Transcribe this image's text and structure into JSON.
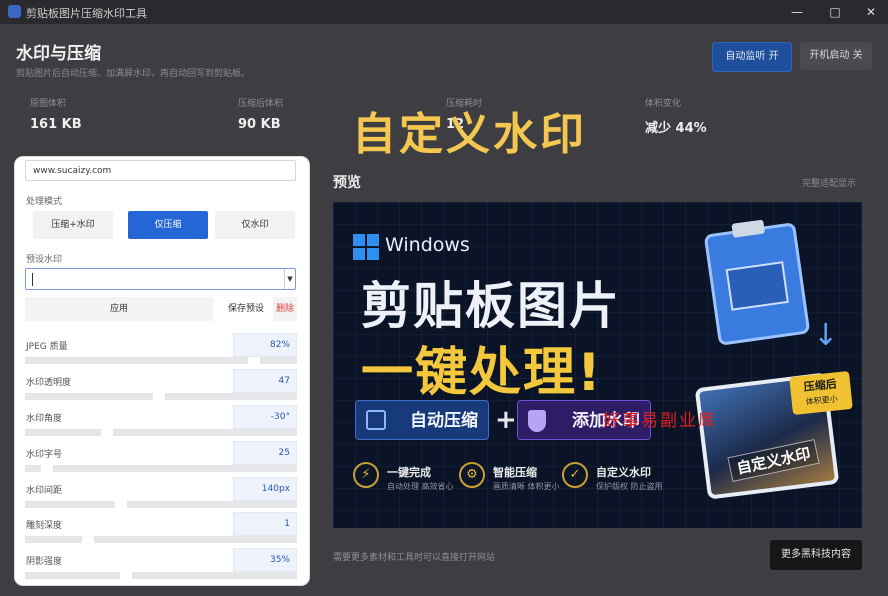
{
  "window": {
    "title": "剪贴板图片压缩水印工具",
    "minimize": "—",
    "maximize": "□",
    "close": "✕"
  },
  "header": {
    "title": "水印与压缩",
    "subtitle": "剪贴图片后自动压缩、加满屏水印，再自动回写到剪贴板。"
  },
  "top_buttons": {
    "auto_monitor": "自动监听  开",
    "boot_start": "开机启动  关"
  },
  "stats": [
    {
      "label": "原图体积",
      "value": "161 KB"
    },
    {
      "label": "压缩后体积",
      "value": "90 KB"
    },
    {
      "label": "压缩耗时",
      "value": "12"
    },
    {
      "label": "体积变化",
      "value": "减少 44%"
    }
  ],
  "overlay_title": "自定义水印",
  "preview": {
    "label": "预览",
    "link": "完整适配显示"
  },
  "banner": {
    "windows_text": "Windows",
    "line1": "剪贴板图片",
    "line2": "一键处理!",
    "tag_compress": "自动压缩",
    "plus": "+",
    "tag_watermark": "添加水印",
    "badge_title": "压缩后",
    "badge_sub": "体积更小",
    "photo_watermark": "自定义水印",
    "red_watermark": "好事易副业库",
    "features": [
      {
        "icon": "lightning-icon",
        "title": "一键完成",
        "desc": "自动处理 高效省心"
      },
      {
        "icon": "gear-icon",
        "title": "智能压缩",
        "desc": "画质清晰 体积更小"
      },
      {
        "icon": "shield-icon",
        "title": "自定义水印",
        "desc": "保护版权 防止盗用"
      }
    ]
  },
  "footer": {
    "note": "需要更多素材和工具时可以直接打开网站",
    "more_button": "更多黑科技内容"
  },
  "panel": {
    "watermark_text": "www.sucaizy.com",
    "mode_label": "处理模式",
    "modes": [
      "压缩+水印",
      "仅压缩",
      "仅水印"
    ],
    "active_mode": "仅压缩",
    "preset_label": "预设水印",
    "preset_value": "",
    "apply_button": "应用",
    "save_preset_button": "保存预设",
    "delete_button": "删除",
    "sliders": [
      {
        "label": "JPEG 质量",
        "value": "82%",
        "level": 0.82
      },
      {
        "label": "水印透明度",
        "value": "47",
        "level": 0.47
      },
      {
        "label": "水印角度",
        "value": "-30°",
        "level": 0.28
      },
      {
        "label": "水印字号",
        "value": "25",
        "level": 0.06
      },
      {
        "label": "水印间距",
        "value": "140px",
        "level": 0.33
      },
      {
        "label": "雕刻深度",
        "value": "1",
        "level": 0.21
      },
      {
        "label": "阴影强度",
        "value": "35%",
        "level": 0.35
      }
    ]
  },
  "colors": {
    "accent": "#2466d6",
    "overlay_yellow": "#f4c850",
    "danger": "#e0403c",
    "dim_bg": "#3d3d42"
  }
}
